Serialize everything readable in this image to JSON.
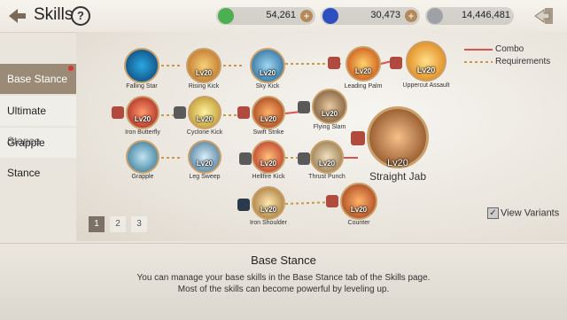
{
  "header": {
    "title": "Skills",
    "help_label": "?"
  },
  "currencies": [
    {
      "name": "gold",
      "value": "54,261",
      "plus": "+",
      "color": "#4caf50"
    },
    {
      "name": "gems",
      "value": "30,473",
      "plus": "+",
      "color": "#2e4fbf"
    },
    {
      "name": "silver",
      "value": "14,446,481",
      "color": "#9ea1a6"
    }
  ],
  "sidebar": {
    "items": [
      {
        "label": "Base Stance",
        "active": true
      },
      {
        "label": "Ultimate Stance"
      },
      {
        "label": "Grapple Stance"
      }
    ]
  },
  "legend": {
    "combo": "Combo",
    "requirements": "Requirements"
  },
  "skills": [
    {
      "name": "Falling Star",
      "level": ""
    },
    {
      "name": "Rising Kick",
      "level": "Lv20"
    },
    {
      "name": "Sky Kick",
      "level": "Lv20"
    },
    {
      "name": "Leading Palm",
      "level": "Lv20"
    },
    {
      "name": "Uppercut Assault",
      "level": "Lv20"
    },
    {
      "name": "Iron Butterfly",
      "level": "Lv20"
    },
    {
      "name": "Cyclone Kick",
      "level": "Lv20"
    },
    {
      "name": "Swift Strike",
      "level": "Lv20"
    },
    {
      "name": "Flying Slam",
      "level": "Lv20"
    },
    {
      "name": "Straight Jab",
      "level": "Lv20"
    },
    {
      "name": "Grapple",
      "level": ""
    },
    {
      "name": "Leg Sweep",
      "level": "Lv20"
    },
    {
      "name": "Hellfire Kick",
      "level": "Lv20"
    },
    {
      "name": "Thrust Punch",
      "level": "Lv20"
    },
    {
      "name": "Iron Shoulder",
      "level": "Lv20"
    },
    {
      "name": "Counter",
      "level": "Lv20"
    }
  ],
  "pagination": {
    "pages": [
      "1",
      "2",
      "3"
    ],
    "current": "1"
  },
  "view_variants": {
    "label": "View Variants",
    "checked": true
  },
  "description": {
    "title": "Base Stance",
    "line1": "You can manage your base skills in the Base Stance tab of the Skills page.",
    "line2": "Most of the skills can become powerful by leveling up."
  },
  "colors": {
    "combo": "#d9534f",
    "requirements": "#c79a4e",
    "nav_active": "#9b8b76"
  }
}
